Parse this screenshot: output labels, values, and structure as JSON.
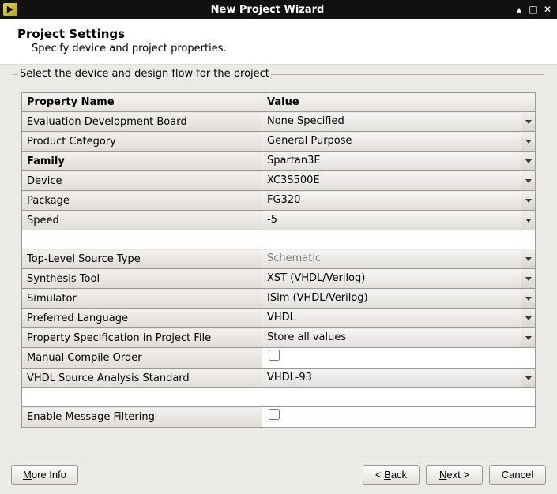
{
  "window": {
    "title": "New Project Wizard"
  },
  "header": {
    "title": "Project Settings",
    "subtitle": "Specify device and project properties."
  },
  "group": {
    "legend": "Select the device and design flow for the project"
  },
  "table": {
    "head": {
      "c1": "Property Name",
      "c2": "Value"
    },
    "rows": [
      {
        "label": "Evaluation Development Board",
        "value": "None Specified",
        "combo": true
      },
      {
        "label": "Product Category",
        "value": "General Purpose",
        "combo": true
      },
      {
        "label": "Family",
        "value": "Spartan3E",
        "combo": true,
        "bold": true
      },
      {
        "label": "Device",
        "value": "XC3S500E",
        "combo": true
      },
      {
        "label": "Package",
        "value": "FG320",
        "combo": true
      },
      {
        "label": "Speed",
        "value": "-5",
        "combo": true
      }
    ],
    "rows2": [
      {
        "label": "Top-Level Source Type",
        "value": "Schematic",
        "combo": true,
        "disabled": true
      },
      {
        "label": "Synthesis Tool",
        "value": "XST (VHDL/Verilog)",
        "combo": true
      },
      {
        "label": "Simulator",
        "value": "ISim (VHDL/Verilog)",
        "combo": true
      },
      {
        "label": "Preferred Language",
        "value": "VHDL",
        "combo": true
      },
      {
        "label": "Property Specification in Project File",
        "value": "Store all values",
        "combo": true
      },
      {
        "label": "Manual Compile Order",
        "value": "",
        "checkbox": true
      },
      {
        "label": "VHDL Source Analysis Standard",
        "value": "VHDL-93",
        "combo": true
      }
    ],
    "rows3": [
      {
        "label": "Enable Message Filtering",
        "value": "",
        "checkbox": true
      }
    ]
  },
  "footer": {
    "more_info": "More Info",
    "back": "< Back",
    "next": "Next >",
    "cancel": "Cancel"
  }
}
